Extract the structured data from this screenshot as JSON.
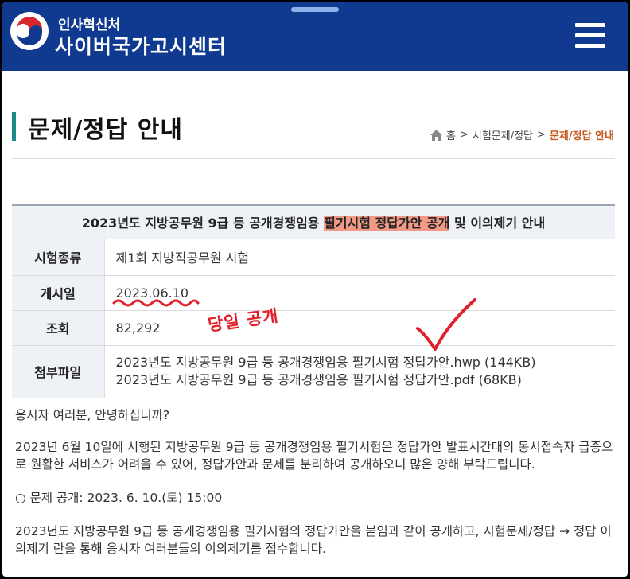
{
  "header": {
    "org_name": "인사혁신처",
    "site_name": "사이버국가고시센터"
  },
  "page": {
    "title": "문제/정답 안내"
  },
  "breadcrumb": {
    "home": "홈",
    "sep": ">",
    "level1": "시험문제/정답",
    "current": "문제/정답 안내"
  },
  "post": {
    "title_before": "2023년도 지방공무원 9급 등 공개경쟁임용 ",
    "title_highlight": "필기시험 정답가안 공개",
    "title_after": " 및 이의제기 안내",
    "rows": [
      {
        "label": "시험종류",
        "value": "제1회 지방직공무원 시험"
      },
      {
        "label": "게시일",
        "value": "2023.06.10"
      },
      {
        "label": "조회",
        "value": "82,292"
      },
      {
        "label": "첨부파일",
        "files": [
          "2023년도 지방공무원 9급 등 공개경쟁임용 필기시험 정답가안.hwp (144KB)",
          "2023년도 지방공무원 9급 등 공개경쟁임용 필기시험 정답가안.pdf (68KB)"
        ]
      }
    ]
  },
  "annotation": {
    "note": "당일 공개",
    "color": "#e0202a"
  },
  "body": {
    "greeting": "응시자 여러분, 안녕하십니까?",
    "para1": "2023년 6월 10일에 시행된 지방공무원 9급 등 공개경쟁임용 필기시험은 정답가안 발표시간대의 동시접속자 급증으로 원활한 서비스가 어려울 수 있어, 정답가안과 문제를 분리하여 공개하오니 많은 양해 부탁드립니다.",
    "schedule": "○ 문제 공개: 2023. 6. 10.(토) 15:00",
    "para2": "2023년도 지방공무원 9급 등 공개경쟁임용 필기시험의 정답가안을 붙임과 같이 공개하고,  시험문제/정답 → 정답 이의제기 란을 통해 응시자 여러분들의 이의제기를 접수합니다."
  },
  "colors": {
    "header_bg": "#0f3a8f",
    "title_accent": "#1a8a8a",
    "breadcrumb_current": "#c8561c",
    "highlight": "#f39a86"
  }
}
